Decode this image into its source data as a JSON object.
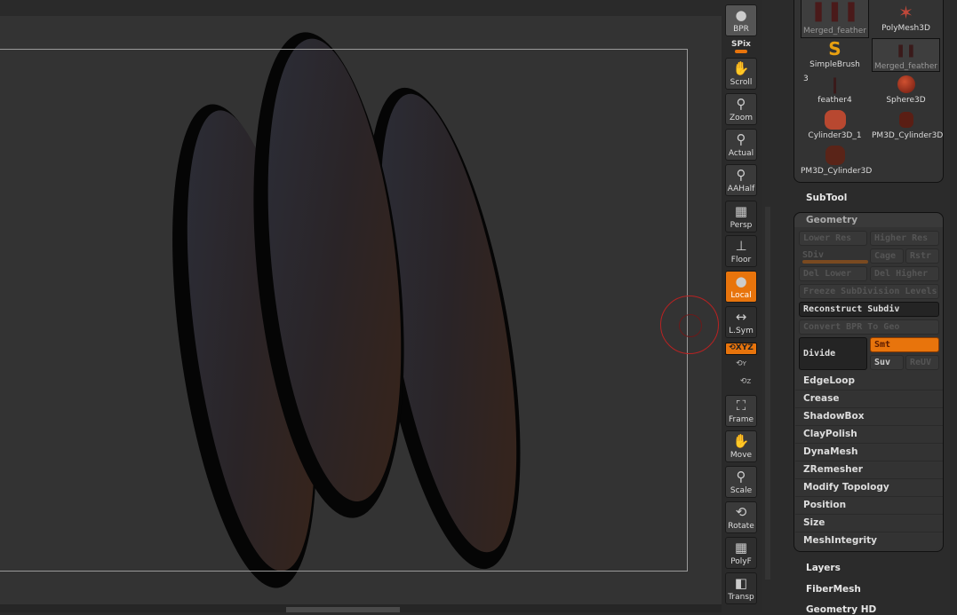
{
  "toolbar": [
    {
      "label": "BPR",
      "icon": "bpr-sphere-icon"
    },
    {
      "label": "SPix",
      "icon": "spix-slider"
    },
    {
      "label": "Scroll",
      "icon": "hand-icon"
    },
    {
      "label": "Zoom",
      "icon": "magnifier-icon"
    },
    {
      "label": "Actual",
      "icon": "magnifier-x1-icon"
    },
    {
      "label": "AAHalf",
      "icon": "magnifier-half-icon"
    },
    {
      "label": "Persp",
      "icon": "grid-perspective-icon"
    },
    {
      "label": "Floor",
      "icon": "floor-icon"
    },
    {
      "label": "Local",
      "icon": "local-rotate-icon",
      "active": true
    },
    {
      "label": "L.Sym",
      "icon": "symmetry-icon"
    },
    {
      "label": "XYZ",
      "icon": "rotate-xyz-icon",
      "active": true
    },
    {
      "label": "Y",
      "icon": "rotate-y-icon"
    },
    {
      "label": "Z",
      "icon": "rotate-z-icon"
    },
    {
      "label": "Frame",
      "icon": "frame-icon"
    },
    {
      "label": "Move",
      "icon": "move-hand-icon"
    },
    {
      "label": "Scale",
      "icon": "scale-icon"
    },
    {
      "label": "Rotate",
      "icon": "rotate-icon"
    },
    {
      "label": "PolyF",
      "icon": "polyframe-icon"
    },
    {
      "label": "Transp",
      "icon": "transparency-icon"
    }
  ],
  "tools": [
    {
      "label": "Merged_feather",
      "selected": true
    },
    {
      "label": "PolyMesh3D"
    },
    {
      "label": "SimpleBrush"
    },
    {
      "label": "Merged_feather",
      "selected": true
    },
    {
      "label": "feather4",
      "badge": "3"
    },
    {
      "label": "Sphere3D"
    },
    {
      "label": "Cylinder3D_1"
    },
    {
      "label": "PM3D_Cylinder3D"
    },
    {
      "label": "PM3D_Cylinder3D"
    }
  ],
  "subtool": "SubTool",
  "geometry": {
    "title": "Geometry",
    "lower_res": "Lower Res",
    "higher_res": "Higher Res",
    "sdiv": "SDiv",
    "cage": "Cage",
    "rstr": "Rstr",
    "del_lower": "Del Lower",
    "del_higher": "Del Higher",
    "freeze": "Freeze SubDivision Levels",
    "reconstruct": "Reconstruct Subdiv",
    "convert": "Convert BPR To Geo",
    "divide": "Divide",
    "smt": "Smt",
    "suv": "Suv",
    "reuv": "ReUV",
    "sections": [
      "EdgeLoop",
      "Crease",
      "ShadowBox",
      "ClayPolish",
      "DynaMesh",
      "ZRemesher",
      "Modify Topology",
      "Position",
      "Size",
      "MeshIntegrity"
    ]
  },
  "after": [
    "Layers",
    "FiberMesh",
    "Geometry HD"
  ],
  "colors": {
    "accent": "#e8740c",
    "cursor": "#b82222"
  }
}
